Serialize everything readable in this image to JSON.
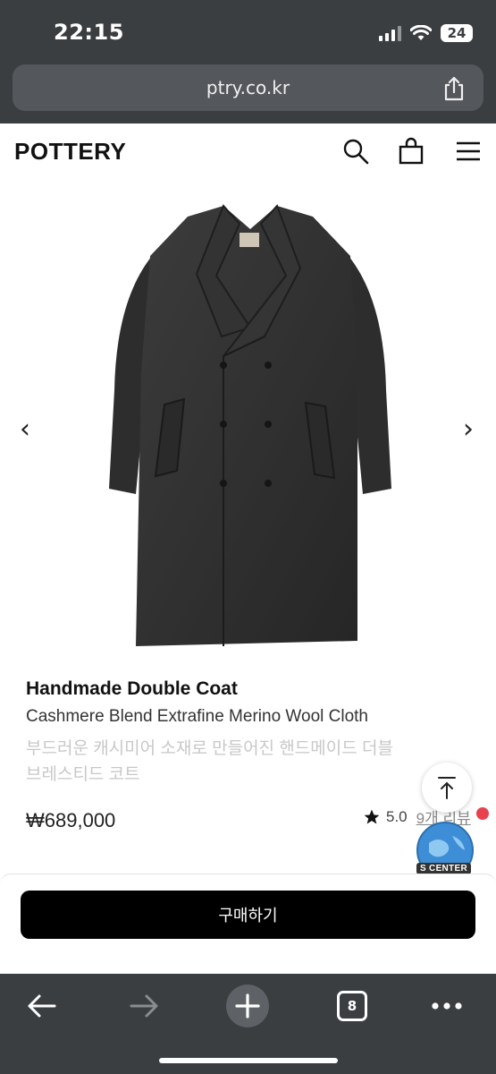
{
  "status_bar": {
    "time": "22:15",
    "battery": "24"
  },
  "browser": {
    "url": "ptry.co.kr",
    "tabs_count": "8"
  },
  "site": {
    "logo": "POTTERY"
  },
  "gallery": {
    "prev": "‹",
    "next": "›"
  },
  "product": {
    "title": "Handmade Double Coat",
    "subtitle": "Cashmere Blend Extrafine Merino Wool Cloth",
    "description": "부드러운 캐시미어 소재로 만들어진 핸드메이드 더블 브레스티드 코트",
    "price": "₩689,000",
    "rating": "5.0",
    "reviews": "9개 리뷰"
  },
  "cs_badge": "S CENTER",
  "buy": {
    "label": "구매하기"
  },
  "icons": [
    "share-icon",
    "search-icon",
    "shopping-bag-icon",
    "menu-icon",
    "star-icon",
    "arrow-up-icon",
    "back-icon",
    "forward-icon",
    "plus-icon",
    "more-icon"
  ]
}
